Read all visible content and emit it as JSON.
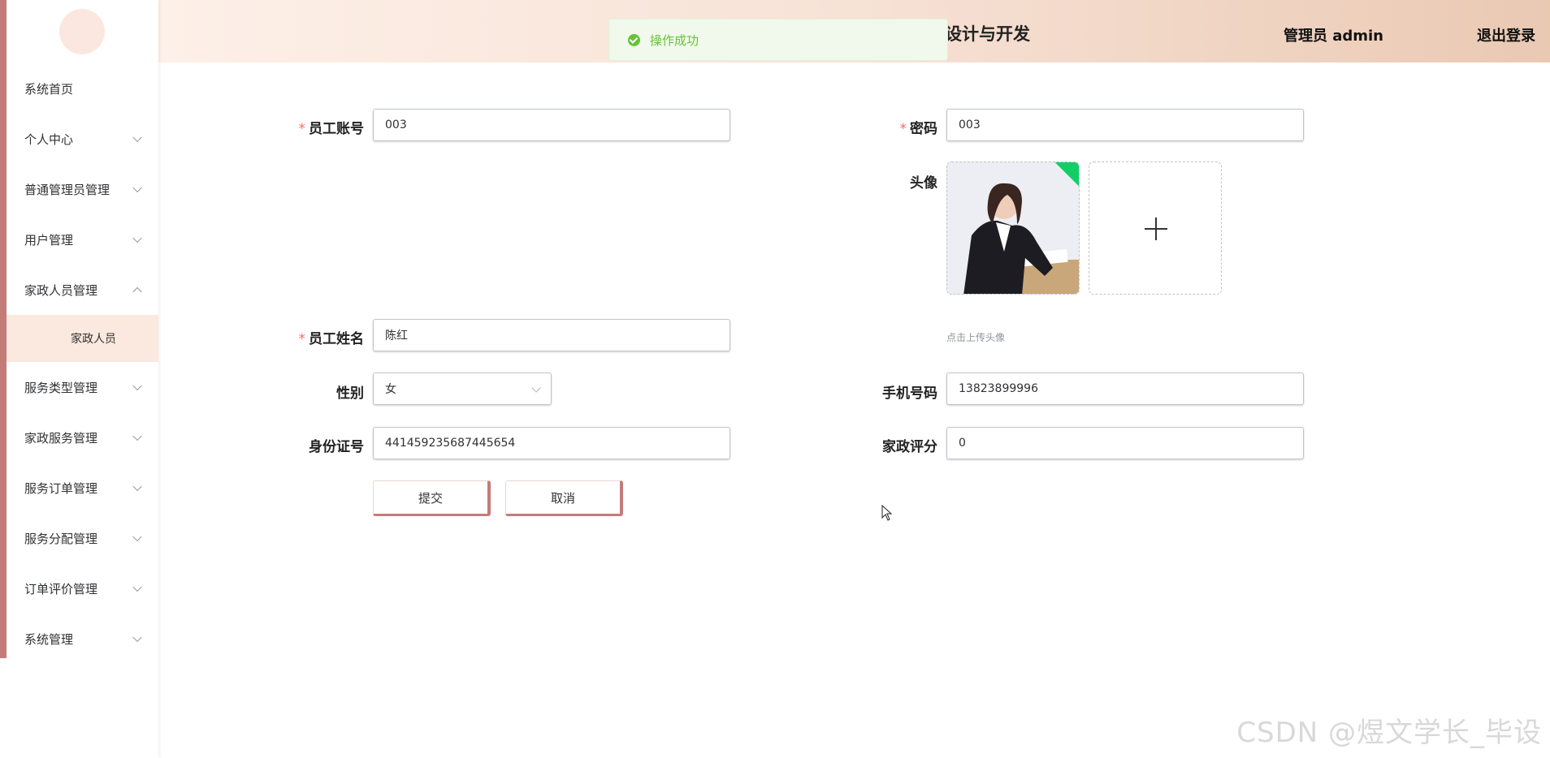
{
  "header": {
    "title": "设计与开发",
    "user": "管理员 admin",
    "logout": "退出登录"
  },
  "toast": {
    "message": "操作成功"
  },
  "sidebar": {
    "items": [
      {
        "label": "系统首页"
      },
      {
        "label": "个人中心"
      },
      {
        "label": "普通管理员管理"
      },
      {
        "label": "用户管理"
      },
      {
        "label": "家政人员管理"
      },
      {
        "label": "服务类型管理"
      },
      {
        "label": "家政服务管理"
      },
      {
        "label": "服务订单管理"
      },
      {
        "label": "服务分配管理"
      },
      {
        "label": "订单评价管理"
      },
      {
        "label": "系统管理"
      }
    ],
    "active_sub": "家政人员"
  },
  "form": {
    "account_label": "员工账号",
    "account_value": "003",
    "password_label": "密码",
    "password_value": "003",
    "avatar_label": "头像",
    "avatar_hint": "点击上传头像",
    "name_label": "员工姓名",
    "name_value": "陈红",
    "gender_label": "性别",
    "gender_value": "女",
    "phone_label": "手机号码",
    "phone_value": "13823899996",
    "idcard_label": "身份证号",
    "idcard_value": "441459235687445654",
    "rating_label": "家政评分",
    "rating_value": "0",
    "submit": "提交",
    "cancel": "取消"
  },
  "watermark": "CSDN @煜文学长_毕设",
  "colors": {
    "accent": "#c47c78",
    "success": "#67c23a",
    "required": "#f56c6c"
  }
}
